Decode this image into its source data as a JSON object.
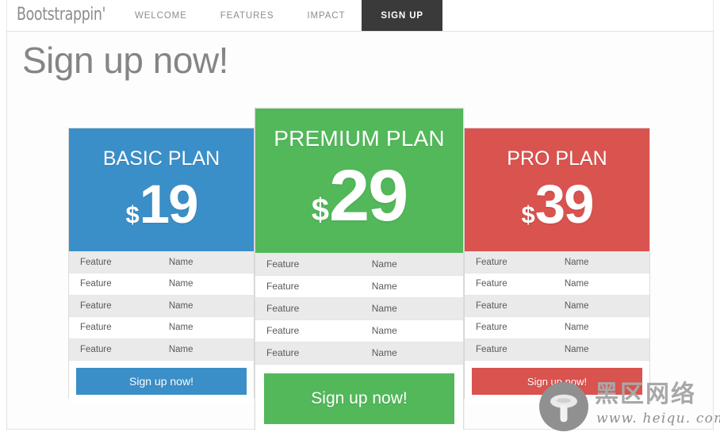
{
  "navbar": {
    "brand": "Bootstrappin'",
    "links": [
      {
        "label": "WELCOME",
        "active": false
      },
      {
        "label": "FEATURES",
        "active": false
      },
      {
        "label": "IMPACT",
        "active": false
      },
      {
        "label": "SIGN UP",
        "active": true
      }
    ]
  },
  "page": {
    "title": "Sign up now!"
  },
  "colors": {
    "basic": "#3b8fc8",
    "premium": "#52b85a",
    "pro": "#d9534f",
    "navbar_active": "#3a3a3a",
    "heading_text": "#858585",
    "row_alt": "#eaeaea"
  },
  "plans": [
    {
      "id": "basic",
      "name": "BASIC PLAN",
      "currency": "$",
      "price": "19",
      "features": [
        {
          "label": "Feature",
          "value": "Name"
        },
        {
          "label": "Feature",
          "value": "Name"
        },
        {
          "label": "Feature",
          "value": "Name"
        },
        {
          "label": "Feature",
          "value": "Name"
        },
        {
          "label": "Feature",
          "value": "Name"
        }
      ],
      "cta": "Sign up now!"
    },
    {
      "id": "premium",
      "name": "PREMIUM PLAN",
      "currency": "$",
      "price": "29",
      "features": [
        {
          "label": "Feature",
          "value": "Name"
        },
        {
          "label": "Feature",
          "value": "Name"
        },
        {
          "label": "Feature",
          "value": "Name"
        },
        {
          "label": "Feature",
          "value": "Name"
        },
        {
          "label": "Feature",
          "value": "Name"
        }
      ],
      "cta": "Sign up now!"
    },
    {
      "id": "pro",
      "name": "PRO PLAN",
      "currency": "$",
      "price": "39",
      "features": [
        {
          "label": "Feature",
          "value": "Name"
        },
        {
          "label": "Feature",
          "value": "Name"
        },
        {
          "label": "Feature",
          "value": "Name"
        },
        {
          "label": "Feature",
          "value": "Name"
        },
        {
          "label": "Feature",
          "value": "Name"
        }
      ],
      "cta": "Sign up now!"
    }
  ],
  "watermark": {
    "name_cn": "黑区网络",
    "url": "www. heiqu. com"
  }
}
